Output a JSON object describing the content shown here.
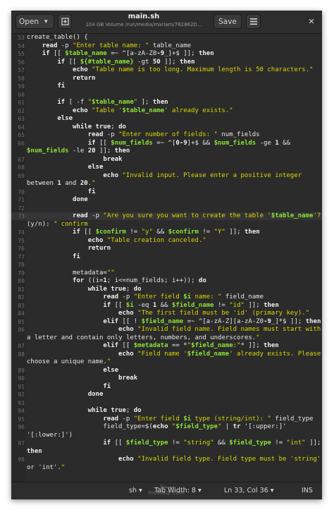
{
  "header": {
    "open_label": "Open",
    "title": "main.sh",
    "subtitle": "104 GB Volume /run/media/mariam/782862D...",
    "save_label": "Save"
  },
  "editor": {
    "current_line": "73",
    "lines": [
      {
        "n": "53",
        "text": "create_table() {"
      },
      {
        "n": "54",
        "text": "    read -p \"Enter table name: \" table_name"
      },
      {
        "n": "55",
        "text": "    if [[ $table_name =~ ^[a-zA-Z0-9_]+$ ]]; then"
      },
      {
        "n": "56",
        "text": "        if [[ ${#table_name} -gt 50 ]]; then"
      },
      {
        "n": "57",
        "text": "            echo \"Table name is too long. Maximum length is 50 characters.\""
      },
      {
        "n": "58",
        "text": "            return"
      },
      {
        "n": "59",
        "text": "        fi"
      },
      {
        "n": "60",
        "text": ""
      },
      {
        "n": "61",
        "text": "        if [ -f \"$table_name\" ]; then"
      },
      {
        "n": "62",
        "text": "            echo \"Table '$table_name' already exists.\""
      },
      {
        "n": "63",
        "text": "        else"
      },
      {
        "n": "64",
        "text": "            while true; do"
      },
      {
        "n": "65",
        "text": "                read -p \"Enter number of fields: \" num_fields"
      },
      {
        "n": "66",
        "text": "                if [[ $num_fields =~ ^[0-9]+$ && $num_fields -ge 1 &&"
      },
      {
        "n": "",
        "text": "$num_fields -le 20 ]]; then"
      },
      {
        "n": "67",
        "text": "                    break"
      },
      {
        "n": "68",
        "text": "                else"
      },
      {
        "n": "69",
        "text": "                    echo \"Invalid input. Please enter a positive integer"
      },
      {
        "n": "",
        "text": "between 1 and 20.\""
      },
      {
        "n": "70",
        "text": "                fi"
      },
      {
        "n": "71",
        "text": "            done"
      },
      {
        "n": "72",
        "text": ""
      },
      {
        "n": "73",
        "text": "            read -p \"Are you sure you want to create the table '$table_name'?"
      },
      {
        "n": "",
        "text": "(y/n): \" confirm"
      },
      {
        "n": "74",
        "text": "            if [[ $confirm != \"y\" && $confirm != \"Y\" ]]; then"
      },
      {
        "n": "75",
        "text": "                echo \"Table creation canceled.\""
      },
      {
        "n": "76",
        "text": "                return"
      },
      {
        "n": "77",
        "text": "            fi"
      },
      {
        "n": "78",
        "text": ""
      },
      {
        "n": "79",
        "text": "            metadata=\"\""
      },
      {
        "n": "80",
        "text": "            for ((i=1; i<=num_fields; i++)); do"
      },
      {
        "n": "81",
        "text": "                while true; do"
      },
      {
        "n": "82",
        "text": "                    read -p \"Enter field $i name: \" field_name"
      },
      {
        "n": "83",
        "text": "                    if [[ $i -eq 1 && $field_name != \"id\" ]]; then"
      },
      {
        "n": "84",
        "text": "                        echo \"The first field must be 'id' (primary key).\""
      },
      {
        "n": "85",
        "text": "                    elif [[ ! $field_name =~ ^[a-zA-Z][a-zA-Z0-9_]*$ ]]; then"
      },
      {
        "n": "86",
        "text": "                        echo \"Invalid field name. Field names must start with"
      },
      {
        "n": "",
        "text": "a letter and contain only letters, numbers, and underscores.\""
      },
      {
        "n": "87",
        "text": "                    elif [[ $metadata == *\"$field_name:\"* ]]; then"
      },
      {
        "n": "88",
        "text": "                        echo \"Field name '$field_name' already exists. Please"
      },
      {
        "n": "",
        "text": "choose a unique name.\""
      },
      {
        "n": "89",
        "text": "                    else"
      },
      {
        "n": "90",
        "text": "                        break"
      },
      {
        "n": "91",
        "text": "                    fi"
      },
      {
        "n": "92",
        "text": "                done"
      },
      {
        "n": "93",
        "text": ""
      },
      {
        "n": "94",
        "text": "                while true; do"
      },
      {
        "n": "95",
        "text": "                    read -p \"Enter field $i type (string/int): \" field_type"
      },
      {
        "n": "96",
        "text": "                    field_type=$(echo \"$field_type\" | tr '[:upper:]'"
      },
      {
        "n": "",
        "text": "'[:lower:]')"
      },
      {
        "n": "97",
        "text": "                    if [[ $field_type != \"string\" && $field_type != \"int\" ]];"
      },
      {
        "n": "",
        "text": "then"
      },
      {
        "n": "98",
        "text": "                        echo \"Invalid field type. Field type must be 'string'"
      },
      {
        "n": "",
        "text": "or 'int'.\""
      }
    ]
  },
  "status": {
    "language": "sh",
    "tab_width": "Tab Width: 8",
    "position": "Ln 33, Col 36",
    "mode": "INS",
    "watermark_top": "مستقل",
    "watermark_bottom": "mostaql.com"
  },
  "colors": {
    "background": "#2b2b2b",
    "keyword": "#f0f0f0",
    "string": "#d7d700",
    "variable": "#8ae234",
    "line_number": "#6f6f6f"
  },
  "icons": {
    "open_chevron": "chevron-down-icon",
    "new_tab": "new-document-icon",
    "menu": "hamburger-menu-icon",
    "close": "close-icon",
    "dropdown": "chevron-down-icon"
  }
}
